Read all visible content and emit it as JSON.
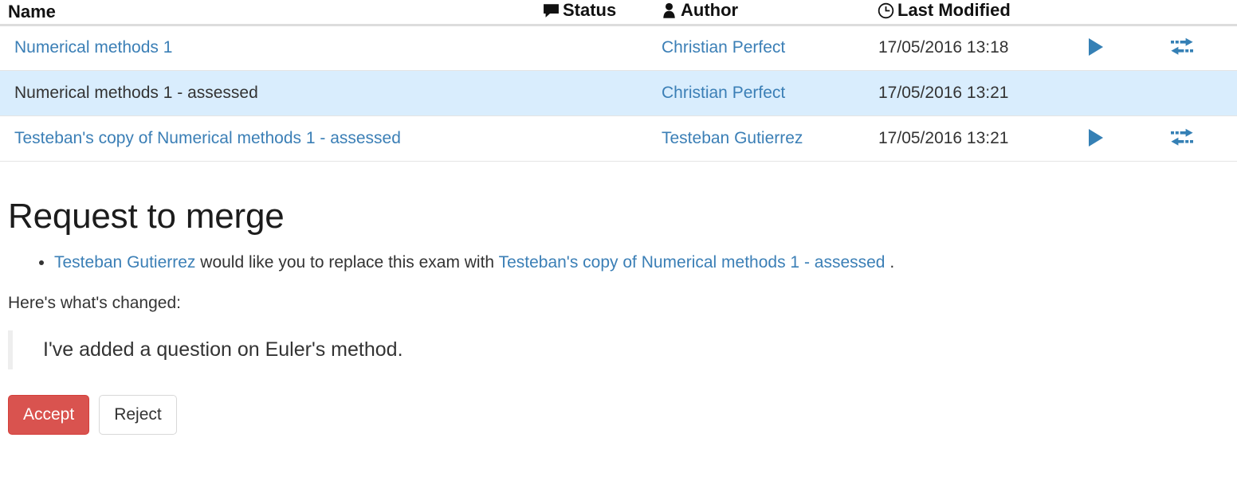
{
  "table": {
    "columns": [
      {
        "key": "name",
        "label": "Name",
        "icon": null
      },
      {
        "key": "status",
        "label": "Status",
        "icon": "comment-icon"
      },
      {
        "key": "author",
        "label": "Author",
        "icon": "user-icon"
      },
      {
        "key": "modified",
        "label": "Last Modified",
        "icon": "clock-icon"
      }
    ],
    "rows": [
      {
        "name": "Numerical methods 1",
        "name_is_link": true,
        "status": "",
        "author": "Christian Perfect",
        "modified": "17/05/2016 13:18",
        "highlighted": false,
        "has_actions": true,
        "run_icon": "play-icon",
        "transfer_icon": "transfer-icon"
      },
      {
        "name": "Numerical methods 1 - assessed",
        "name_is_link": false,
        "status": "",
        "author": "Christian Perfect",
        "modified": "17/05/2016 13:21",
        "highlighted": true,
        "has_actions": false,
        "run_icon": "",
        "transfer_icon": ""
      },
      {
        "name": "Testeban's copy of Numerical methods 1 - assessed",
        "name_is_link": true,
        "status": "",
        "author": "Testeban Gutierrez",
        "modified": "17/05/2016 13:21",
        "highlighted": false,
        "has_actions": true,
        "run_icon": "play-icon",
        "transfer_icon": "transfer-icon"
      }
    ]
  },
  "merge": {
    "title": "Request to merge",
    "request_author": "Testeban Gutierrez",
    "request_text_middle": " would like you to replace this exam with ",
    "request_target": "Testeban's copy of Numerical methods 1 - assessed",
    "request_text_end": " .",
    "changed_label": "Here's what's changed:",
    "changes_quote": "I've added a question on Euler's method.",
    "accept_label": "Accept",
    "reject_label": "Reject"
  },
  "colors": {
    "link": "#3b7fb6",
    "highlight_row": "#d9edfd",
    "accept_bg": "#d9534f",
    "icon_blue": "#3580b5",
    "header_border": "#dddddd"
  }
}
